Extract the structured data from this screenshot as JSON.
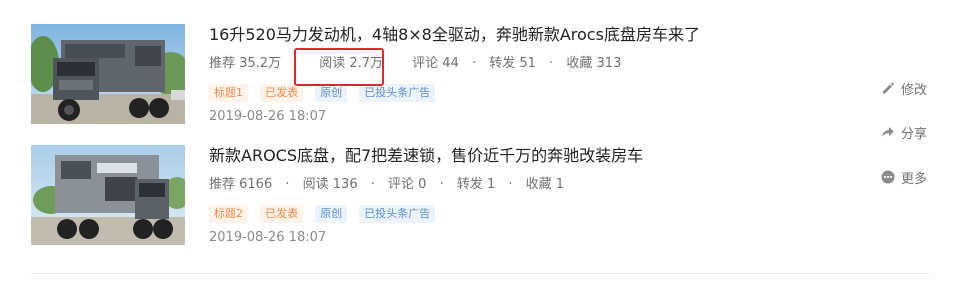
{
  "articles": [
    {
      "title": "16升520马力发动机，4轴8×8全驱动，奔驰新款Arocs底盘房车来了",
      "stats": {
        "recommend": "推荐 35.2万",
        "reads": "阅读 2.7万",
        "comments": "评论 44",
        "shares": "转发 51",
        "favorites": "收藏 313"
      },
      "tags": [
        "标题1",
        "已发表",
        "原创",
        "已投头条广告"
      ],
      "date": "2019-08-26 18:07"
    },
    {
      "title": "新款AROCS底盘，配7把差速锁，售价近千万的奔驰改装房车",
      "stats": {
        "recommend": "推荐 6166",
        "reads": "阅读 136",
        "comments": "评论 0",
        "shares": "转发 1",
        "favorites": "收藏 1"
      },
      "tags": [
        "标题2",
        "已发表",
        "原创",
        "已投头条广告"
      ],
      "date": "2019-08-26 18:07"
    }
  ],
  "actions": {
    "edit": "修改",
    "share": "分享",
    "more": "更多"
  },
  "colors": {
    "highlight": "#e0262b",
    "tag_orange": "#f08c4a",
    "tag_blue": "#5a8dd6"
  },
  "icons": [
    "edit-icon",
    "share-icon",
    "more-icon"
  ]
}
